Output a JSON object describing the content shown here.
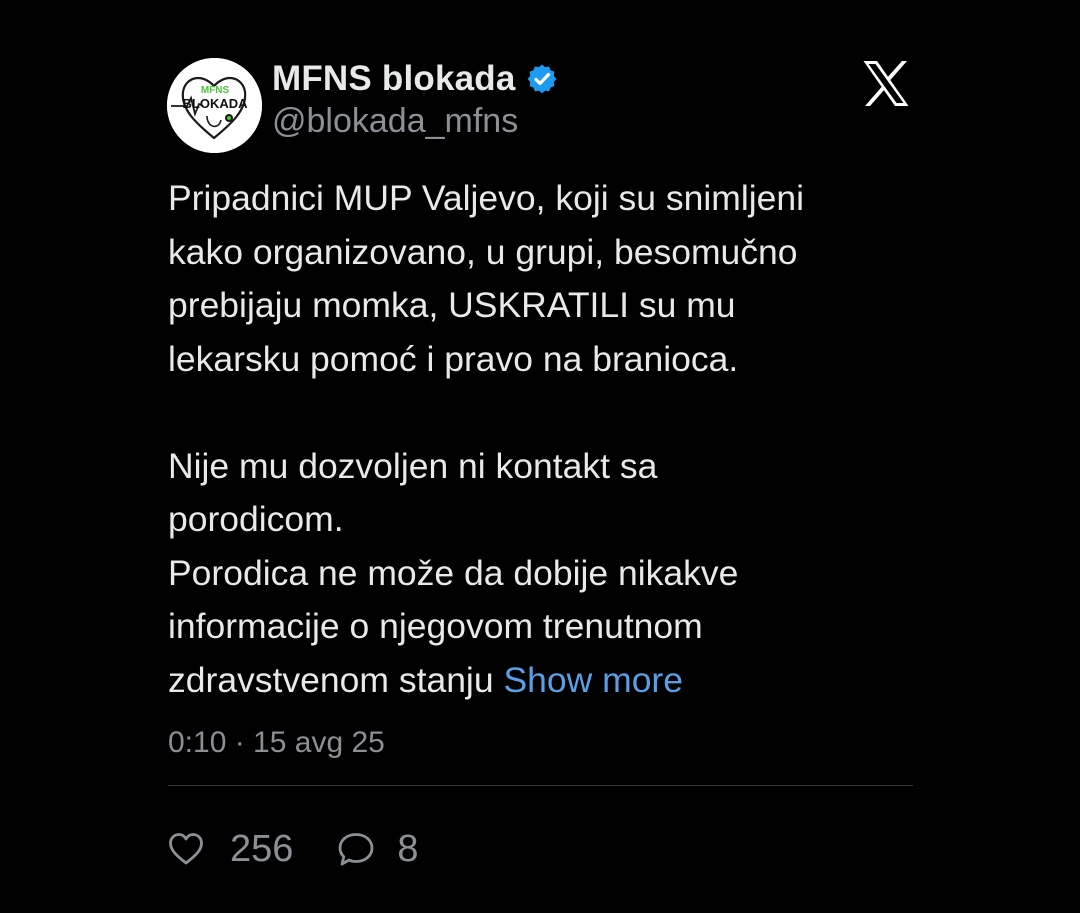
{
  "author": {
    "display_name": "MFNS blokada",
    "handle": "@blokada_mfns",
    "verified": true,
    "avatar_icon": "mfns-blokada-logo",
    "avatar_text_top": "MFNS",
    "avatar_text_main": "BLOKADA"
  },
  "platform_icon": "x-logo-icon",
  "tweet": {
    "paragraphs": [
      [
        "Pripadnici MUP Valjevo, koji su snimljeni",
        "kako organizovano, u grupi, besomučno",
        "prebijaju momka, USKRATILI su mu",
        "lekarsku pomoć i pravo na branioca."
      ],
      [
        "Nije mu dozvoljen ni kontakt sa",
        "porodicom."
      ],
      [
        "Porodica ne može da dobije nikakve",
        "informacije o njegovom trenutnom"
      ]
    ],
    "last_line": "zdravstvenom stanju",
    "show_more": "Show more"
  },
  "timestamp": "0:10 · 15 avg 25",
  "metrics": {
    "likes": "256",
    "replies": "8"
  },
  "colors": {
    "background": "#000000",
    "text": "#e7e9ea",
    "secondary": "#8b9096",
    "link": "#5a9fe6",
    "verified_badge": "#1d9bf0",
    "avatar_accent": "#4cc43a"
  }
}
